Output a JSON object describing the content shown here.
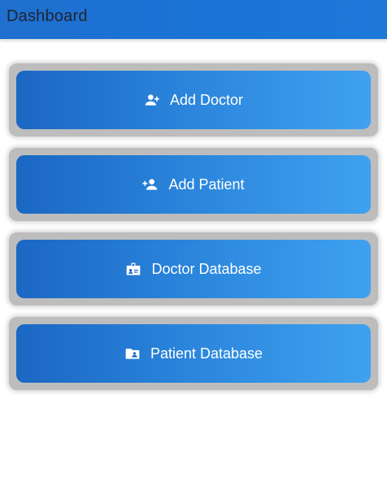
{
  "app_bar": {
    "title": "Dashboard"
  },
  "dashboard": {
    "buttons": [
      {
        "label": "Add Doctor",
        "icon": "person-add-icon"
      },
      {
        "label": "Add Patient",
        "icon": "person-add-icon"
      },
      {
        "label": "Doctor Database",
        "icon": "badge-icon"
      },
      {
        "label": "Patient Database",
        "icon": "folder-shared-icon"
      }
    ]
  },
  "colors": {
    "app_bar": "#1a74d6",
    "button_gradient_start": "#1b67c4",
    "button_gradient_end": "#3fa1f0",
    "card_background": "#bdbdbd",
    "button_text": "#ffffff"
  }
}
